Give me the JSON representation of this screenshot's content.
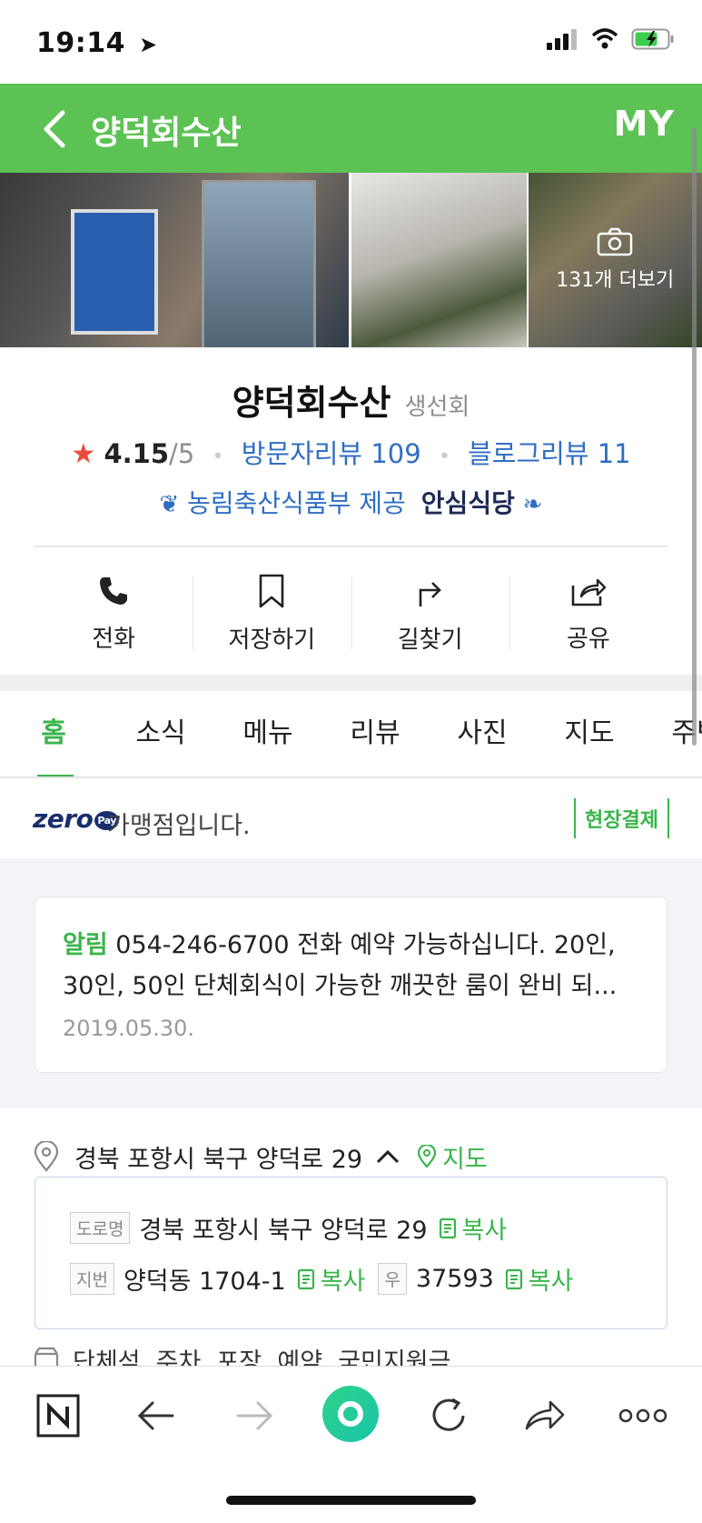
{
  "status_bar": {
    "time": "19:14"
  },
  "header": {
    "title": "양덕회수산",
    "my_label": "MY"
  },
  "photos": {
    "more_label": "131개 더보기"
  },
  "place": {
    "name": "양덕회수산",
    "category": "생선회",
    "rating": "4.15",
    "rating_max": "/5",
    "visitor_reviews": "방문자리뷰 109",
    "blog_reviews": "블로그리뷰 11",
    "badge_provider": "농림축산식품부 제공",
    "badge_name": "안심식당"
  },
  "actions": [
    {
      "label": "전화",
      "icon": "phone-icon"
    },
    {
      "label": "저장하기",
      "icon": "bookmark-icon"
    },
    {
      "label": "길찾기",
      "icon": "directions-icon"
    },
    {
      "label": "공유",
      "icon": "share-icon"
    }
  ],
  "tabs": [
    {
      "label": "홈",
      "active": true
    },
    {
      "label": "소식"
    },
    {
      "label": "메뉴"
    },
    {
      "label": "리뷰"
    },
    {
      "label": "사진"
    },
    {
      "label": "지도"
    },
    {
      "label": "주변"
    }
  ],
  "zeropay": {
    "logo": "zero",
    "logo_sub": "Pay",
    "text": "가맹점입니다.",
    "badge": "현장결제"
  },
  "notice": {
    "label": "알림",
    "text": " 054-246-6700 전화 예약 가능하십니다. 20인, 30인, 50인 단체회식이 가능한 깨끗한 룸이 완비 되...",
    "date": "2019.05.30."
  },
  "address": {
    "summary": "경북 포항시 북구 양덕로 29",
    "map_link": "지도",
    "road_tag": "도로명",
    "road": "경북 포항시 북구 양덕로 29",
    "jibun_tag": "지번",
    "jibun": "양덕동 1704-1",
    "postal_tag": "우",
    "postal": "37593",
    "copy_label": "복사"
  },
  "facilities": "단체석, 주차, 포장, 예약, 국민지원금",
  "colors": {
    "brand_green": "#5dc254",
    "link_blue": "#2f6ec3",
    "accent_green": "#3ab54a"
  }
}
